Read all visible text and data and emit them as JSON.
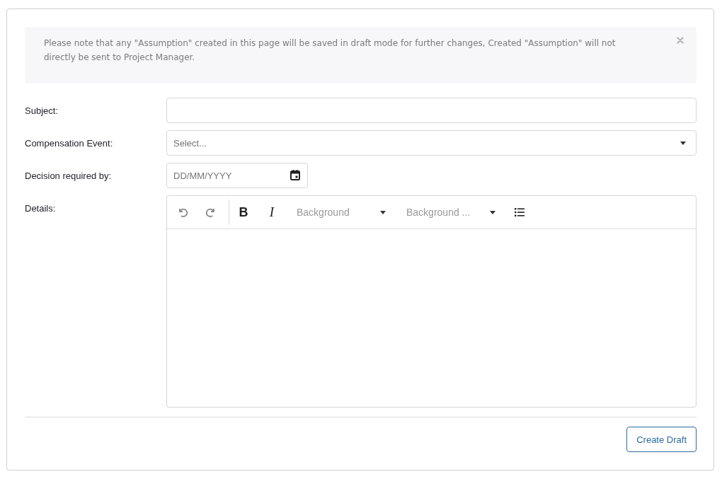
{
  "alert": {
    "message": "Please note that any \"Assumption\" created in this page will be saved in draft mode for further changes, Created \"Assumption\" will not directly be sent to Project Manager.",
    "dismissible": true
  },
  "form": {
    "fields": [
      {
        "kind": "text",
        "label": "Subject:"
      },
      {
        "kind": "select",
        "label": "Compensation Event:",
        "placeholder": "Select..."
      },
      {
        "kind": "date",
        "label": "Decision required by:",
        "placeholder": "DD/MM/YYYY"
      },
      {
        "kind": "editor",
        "label": "Details:",
        "toolbar_groups": [
          {
            "items": [
              {
                "kind": "undo",
                "disabled": true
              },
              {
                "kind": "redo",
                "disabled": true
              }
            ]
          },
          {
            "items": [
              {
                "kind": "bold",
                "glyph": "B",
                "disabled": false
              },
              {
                "kind": "italic",
                "glyph": "I",
                "disabled": false
              },
              {
                "kind": "dropdown",
                "label": "Background",
                "disabled": false
              },
              {
                "kind": "dropdown",
                "label": "Background ...",
                "disabled": false
              },
              {
                "kind": "bullet_list",
                "disabled": false
              }
            ]
          }
        ]
      }
    ]
  },
  "actions": [
    {
      "label": "Create Draft"
    }
  ]
}
